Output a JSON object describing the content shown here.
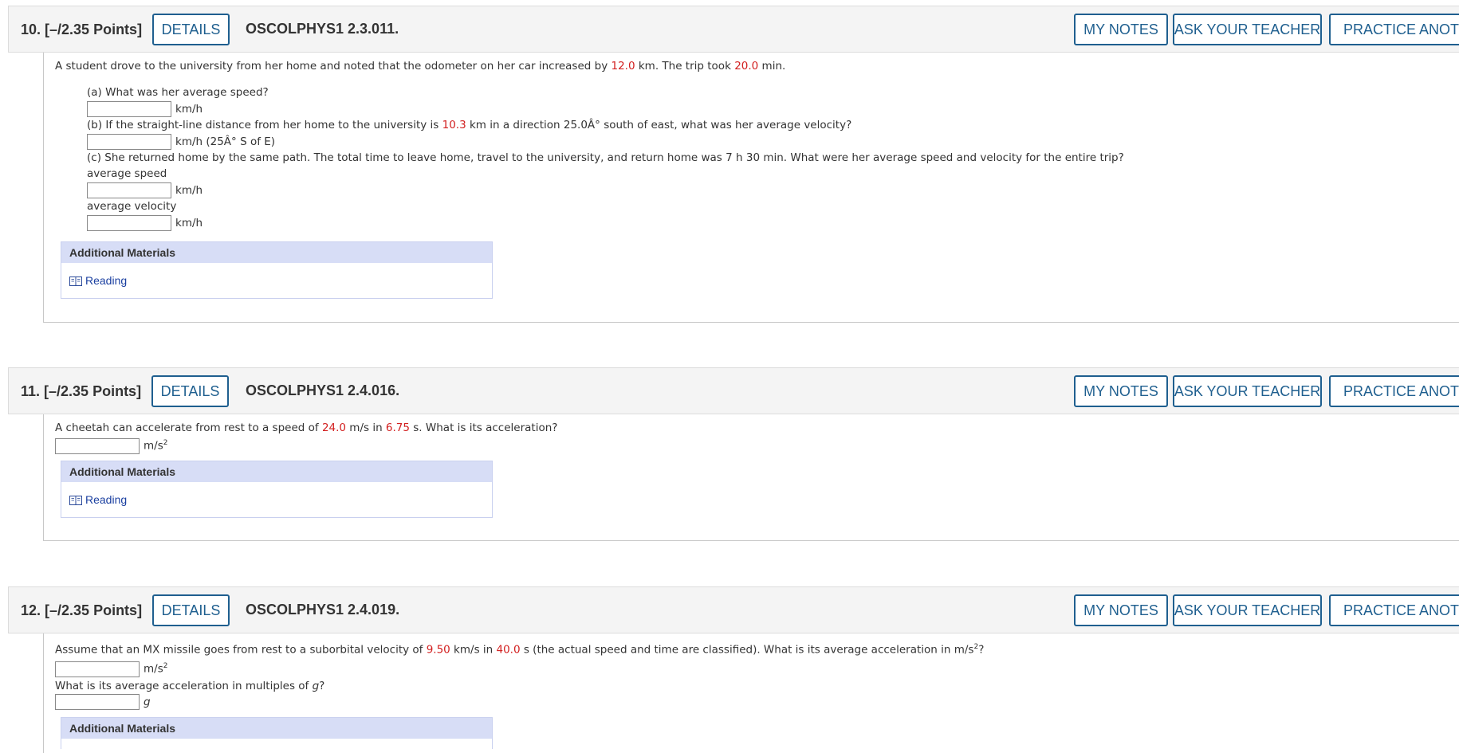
{
  "header_buttons": {
    "details": "DETAILS",
    "my_notes": "MY NOTES",
    "ask_teacher": "ASK YOUR TEACHER",
    "practice": "PRACTICE ANOTHER"
  },
  "additional_materials": {
    "title": "Additional Materials",
    "reading": "Reading"
  },
  "q10": {
    "number": "10. [–/2.35 Points]",
    "code": "OSCOLPHYS1 2.3.011.",
    "intro": {
      "a": "A student drove to the university from her home and noted that the odometer on her car increased by ",
      "v1": "12.0",
      "b": " km. The trip took ",
      "v2": "20.0",
      "c": " min."
    },
    "part_a": {
      "question": "(a) What was her average speed?",
      "unit": "km/h",
      "answer": ""
    },
    "part_b": {
      "a": "(b) If the straight-line distance from her home to the university is ",
      "v": "10.3",
      "b": " km in a direction 25.0Â° south of east, what was her average velocity?",
      "unit": "km/h (25Â° S of E)",
      "answer": ""
    },
    "part_c": {
      "question": "(c) She returned home by the same path. The total time to leave home, travel to the university, and return home was 7 h 30 min. What were her average speed and velocity for the entire trip?",
      "speed_label": "average speed",
      "speed_unit": "km/h",
      "velocity_label": "average velocity",
      "velocity_unit": "km/h",
      "speed_answer": "",
      "velocity_answer": ""
    }
  },
  "q11": {
    "number": "11. [–/2.35 Points]",
    "code": "OSCOLPHYS1 2.4.016.",
    "intro": {
      "a": "A cheetah can accelerate from rest to a speed of ",
      "v1": "24.0",
      "b": " m/s in ",
      "v2": "6.75",
      "c": " s. What is its acceleration?"
    },
    "unit": "m/s",
    "unit_exp": "2",
    "answer": ""
  },
  "q12": {
    "number": "12. [–/2.35 Points]",
    "code": "OSCOLPHYS1 2.4.019.",
    "intro": {
      "a": "Assume that an MX missile goes from rest to a suborbital velocity of ",
      "v1": "9.50",
      "b": " km/s in ",
      "v2": "40.0",
      "c": " s (the actual speed and time are classified). What is its average acceleration in m/s",
      "exp": "2",
      "d": "?"
    },
    "unit1": "m/s",
    "unit1_exp": "2",
    "sub_question": {
      "a": "What is its average acceleration in multiples of ",
      "g": "g",
      "b": "?"
    },
    "unit2": "g",
    "answer1": "",
    "answer2": ""
  }
}
